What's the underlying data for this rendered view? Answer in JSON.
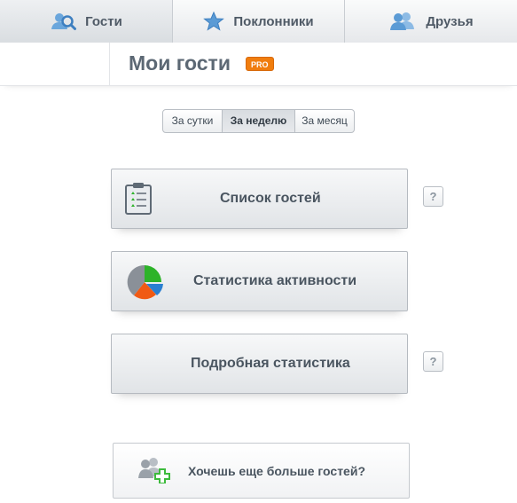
{
  "tabs": [
    {
      "label": "Гости",
      "icon": "magnifier-people-icon",
      "active": true
    },
    {
      "label": "Поклонники",
      "icon": "star-icon",
      "active": false
    },
    {
      "label": "Друзья",
      "icon": "people-icon",
      "active": false
    }
  ],
  "header": {
    "title": "Мои гости",
    "badge": "PRO"
  },
  "period": {
    "options": [
      "За сутки",
      "За неделю",
      "За месяц"
    ],
    "selected": "За неделю"
  },
  "actions": {
    "guest_list": "Список гостей",
    "activity_stats": "Статистика активности",
    "detailed_stats": "Подробная статистика",
    "help_label": "?"
  },
  "promo": {
    "label": "Хочешь еще больше гостей?"
  },
  "colors": {
    "badge": "#f07d0e",
    "tab_icon": "#5b9bd5",
    "pie_green": "#2db329",
    "pie_blue": "#2a7fd1",
    "pie_orange": "#f05a14",
    "pie_gray": "#8a9098",
    "plus_green": "#3dbb3d"
  }
}
